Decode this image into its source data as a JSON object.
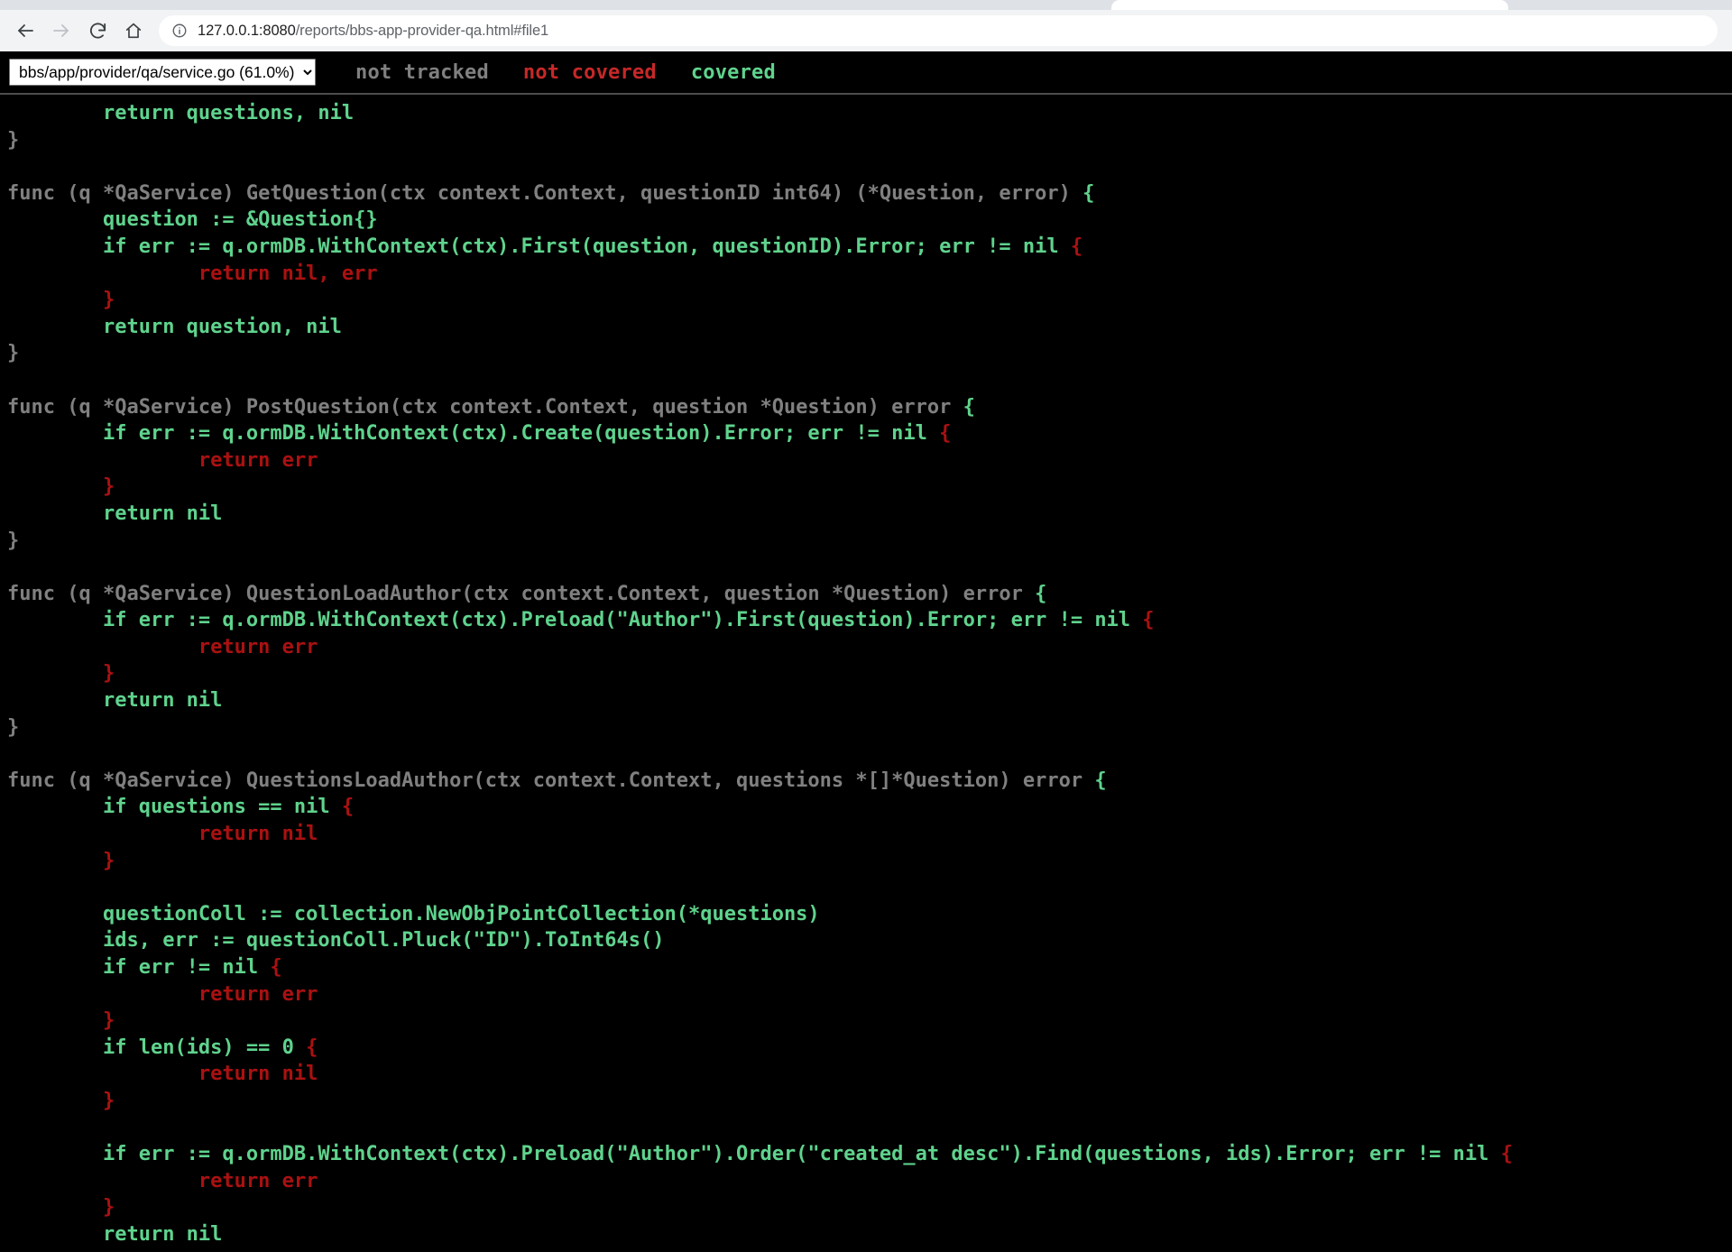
{
  "browser": {
    "back_icon": "arrow-left-icon",
    "forward_icon": "arrow-right-icon",
    "reload_icon": "reload-icon",
    "home_icon": "home-icon",
    "info_icon": "site-info-icon",
    "url_host": "127.0.0.1:8080",
    "url_path": "/reports/bbs-app-provider-qa.html#file1",
    "url_full": "127.0.0.1:8080/reports/bbs-app-provider-qa.html#file1"
  },
  "report": {
    "selected_file": "bbs/app/provider/qa/service.go (61.0%)",
    "file_options": [
      "bbs/app/provider/qa/service.go (61.0%)"
    ],
    "legend": {
      "not_tracked": "not tracked",
      "not_covered": "not covered",
      "covered": "covered"
    },
    "colors": {
      "not_tracked": "#808080",
      "not_covered": "#aa1111",
      "not_covered_legend": "#c62828",
      "covered": "#5fd38d",
      "background": "#000000"
    }
  },
  "code": {
    "lines": [
      [
        [
          "        ",
          "yes"
        ],
        [
          "return questions, nil",
          "yes"
        ]
      ],
      [
        [
          "}",
          "0"
        ]
      ],
      [
        [
          "",
          "0"
        ]
      ],
      [
        [
          "func (q *QaService) GetQuestion(ctx context.Context, questionID int64) (*Question, error) ",
          "0"
        ],
        [
          "{",
          "yes"
        ]
      ],
      [
        [
          "        ",
          "yes"
        ],
        [
          "question := &Question{}",
          "yes"
        ]
      ],
      [
        [
          "        ",
          "yes"
        ],
        [
          "if err := q.ormDB.WithContext(ctx).First(question, questionID).Error; err != nil ",
          "yes"
        ],
        [
          "{",
          "no"
        ]
      ],
      [
        [
          "                ",
          "no"
        ],
        [
          "return nil, err",
          "no"
        ]
      ],
      [
        [
          "        ",
          "no"
        ],
        [
          "}",
          "no"
        ]
      ],
      [
        [
          "        ",
          "yes"
        ],
        [
          "return question, nil",
          "yes"
        ]
      ],
      [
        [
          "}",
          "0"
        ]
      ],
      [
        [
          "",
          "0"
        ]
      ],
      [
        [
          "func (q *QaService) PostQuestion(ctx context.Context, question *Question) error ",
          "0"
        ],
        [
          "{",
          "yes"
        ]
      ],
      [
        [
          "        ",
          "yes"
        ],
        [
          "if err := q.ormDB.WithContext(ctx).Create(question).Error; err != nil ",
          "yes"
        ],
        [
          "{",
          "no"
        ]
      ],
      [
        [
          "                ",
          "no"
        ],
        [
          "return err",
          "no"
        ]
      ],
      [
        [
          "        ",
          "no"
        ],
        [
          "}",
          "no"
        ]
      ],
      [
        [
          "        ",
          "yes"
        ],
        [
          "return nil",
          "yes"
        ]
      ],
      [
        [
          "}",
          "0"
        ]
      ],
      [
        [
          "",
          "0"
        ]
      ],
      [
        [
          "func (q *QaService) QuestionLoadAuthor(ctx context.Context, question *Question) error ",
          "0"
        ],
        [
          "{",
          "yes"
        ]
      ],
      [
        [
          "        ",
          "yes"
        ],
        [
          "if err := q.ormDB.WithContext(ctx).Preload(\"Author\").First(question).Error; err != nil ",
          "yes"
        ],
        [
          "{",
          "no"
        ]
      ],
      [
        [
          "                ",
          "no"
        ],
        [
          "return err",
          "no"
        ]
      ],
      [
        [
          "        ",
          "no"
        ],
        [
          "}",
          "no"
        ]
      ],
      [
        [
          "        ",
          "yes"
        ],
        [
          "return nil",
          "yes"
        ]
      ],
      [
        [
          "}",
          "0"
        ]
      ],
      [
        [
          "",
          "0"
        ]
      ],
      [
        [
          "func (q *QaService) QuestionsLoadAuthor(ctx context.Context, questions *[]*Question) error ",
          "0"
        ],
        [
          "{",
          "yes"
        ]
      ],
      [
        [
          "        ",
          "yes"
        ],
        [
          "if questions == nil ",
          "yes"
        ],
        [
          "{",
          "no"
        ]
      ],
      [
        [
          "                ",
          "no"
        ],
        [
          "return nil",
          "no"
        ]
      ],
      [
        [
          "        ",
          "no"
        ],
        [
          "}",
          "no"
        ]
      ],
      [
        [
          "",
          "0"
        ]
      ],
      [
        [
          "        ",
          "yes"
        ],
        [
          "questionColl := collection.NewObjPointCollection(*questions)",
          "yes"
        ]
      ],
      [
        [
          "        ",
          "yes"
        ],
        [
          "ids, err := questionColl.Pluck(\"ID\").ToInt64s()",
          "yes"
        ]
      ],
      [
        [
          "        ",
          "yes"
        ],
        [
          "if err != nil ",
          "yes"
        ],
        [
          "{",
          "no"
        ]
      ],
      [
        [
          "                ",
          "no"
        ],
        [
          "return err",
          "no"
        ]
      ],
      [
        [
          "        ",
          "no"
        ],
        [
          "}",
          "no"
        ]
      ],
      [
        [
          "        ",
          "yes"
        ],
        [
          "if len(ids) == 0 ",
          "yes"
        ],
        [
          "{",
          "no"
        ]
      ],
      [
        [
          "                ",
          "no"
        ],
        [
          "return nil",
          "no"
        ]
      ],
      [
        [
          "        ",
          "no"
        ],
        [
          "}",
          "no"
        ]
      ],
      [
        [
          "",
          "0"
        ]
      ],
      [
        [
          "        ",
          "yes"
        ],
        [
          "if err := q.ormDB.WithContext(ctx).Preload(\"Author\").Order(\"created_at desc\").Find(questions, ids).Error; err != nil ",
          "yes"
        ],
        [
          "{",
          "no"
        ]
      ],
      [
        [
          "                ",
          "no"
        ],
        [
          "return err",
          "no"
        ]
      ],
      [
        [
          "        ",
          "no"
        ],
        [
          "}",
          "no"
        ]
      ],
      [
        [
          "        ",
          "yes"
        ],
        [
          "return nil",
          "yes"
        ]
      ]
    ]
  }
}
